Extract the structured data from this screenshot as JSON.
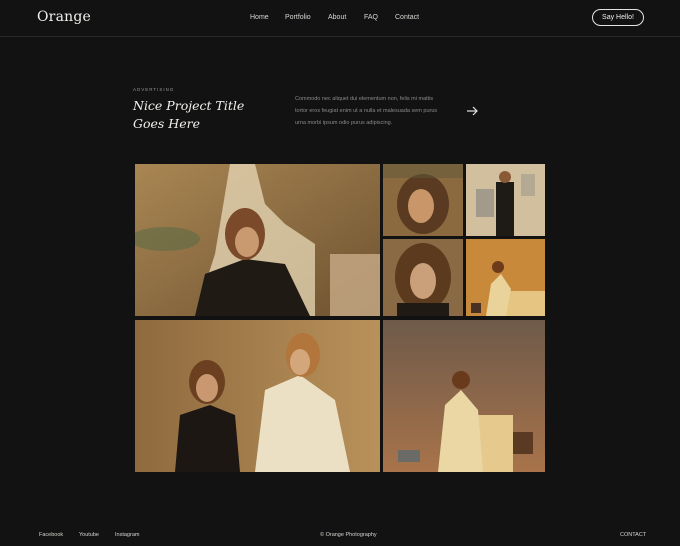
{
  "brand": {
    "logo": "Orange"
  },
  "nav": {
    "items": [
      "Home",
      "Portfolio",
      "About",
      "FAQ",
      "Contact"
    ],
    "cta_label": "Say Hello!"
  },
  "project": {
    "category": "ADVERTISING",
    "title_line1": "Nice Project Title",
    "title_line2": "Goes Here",
    "description": "Commodo nec aliquet dui elementum non, felis mi mattis tortor eros feugiat enim ut a nulla et malesuada sem purus urna morbi ipsum odio purus adipiscing.",
    "arrow_icon": "arrow-right-icon"
  },
  "gallery": {
    "photos": [
      "woman-reclining-main",
      "woman-closeup-hair",
      "two-women-background",
      "woman-portrait-curls",
      "woman-seated-table",
      "two-women-drinks",
      "woman-seated-dress"
    ]
  },
  "footer": {
    "social": [
      "Facebook",
      "Youtube",
      "Instagram"
    ],
    "copyright": "© Orange Photography",
    "contact": "CONTACT"
  },
  "colors": {
    "background": "#121212",
    "text": "#e8e6e3",
    "muted": "#8d8a86",
    "photo_tone": "#b98a4a"
  }
}
